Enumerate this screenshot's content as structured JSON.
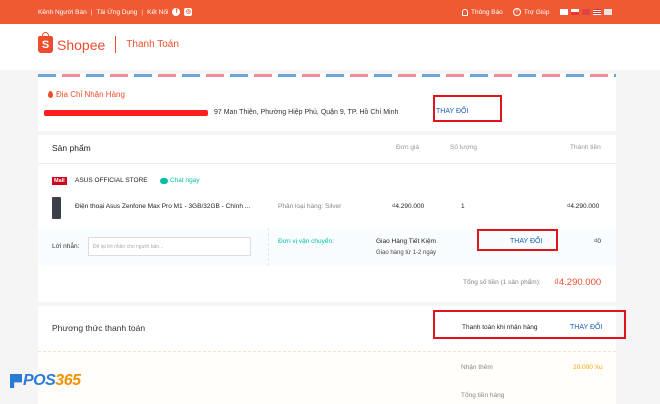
{
  "topbar": {
    "links": [
      "Kênh Người Bán",
      "Tải Ứng Dụng",
      "Kết Nối"
    ],
    "notifications": "Thông Báo",
    "help": "Trợ Giúp"
  },
  "header": {
    "logo": "Shopee",
    "page_title": "Thanh Toán"
  },
  "address": {
    "title": "Địa Chỉ Nhận Hàng",
    "line": "97 Man Thiện, Phường Hiệp Phú, Quận 9, TP. Hồ Chí Minh",
    "change": "THAY ĐỔI"
  },
  "products": {
    "headers": {
      "product": "Sản phẩm",
      "unit_price": "Đơn giá",
      "quantity": "Số lượng",
      "subtotal": "Thành tiền"
    },
    "mall_badge": "Mall",
    "store": "ASUS OFFICIAL STORE",
    "chat": "Chat ngay",
    "item": {
      "name": "Điện thoại Asus Zenfone Max Pro M1 - 3GB/32GB - Chính ...",
      "variant": "Phân loại hàng: Silver",
      "price": "₫4.290.000",
      "qty": "1",
      "total": "₫4.290.000"
    },
    "note_label": "Lời nhắn:",
    "note_placeholder": "Để lại lời nhắn cho người bán...",
    "shipping_label": "Đơn vị vận chuyển:",
    "shipping_name": "Giao Hàng Tiết Kiệm",
    "shipping_eta": "Giao hàng từ 1-2 ngày",
    "shipping_change": "THAY ĐỔI",
    "shipping_fee": "₫0",
    "sum_label": "Tổng số tiền (1 sản phẩm):",
    "sum_value": "₫4.290.000"
  },
  "payment": {
    "title": "Phương thức thanh toán",
    "method": "Thanh toán khi nhận hàng",
    "change": "THAY ĐỔI",
    "rows": [
      {
        "label": "Nhận thêm",
        "value": "20.000 Xu"
      },
      {
        "label": "Tổng tiền hàng",
        "value": ""
      }
    ]
  },
  "watermark": {
    "pos": "POS",
    "num": "365"
  },
  "colors": {
    "brand": "#ee4d2d",
    "link": "#1a5fb4",
    "highlight_box": "#e0151b",
    "teal": "#00bfa5"
  }
}
